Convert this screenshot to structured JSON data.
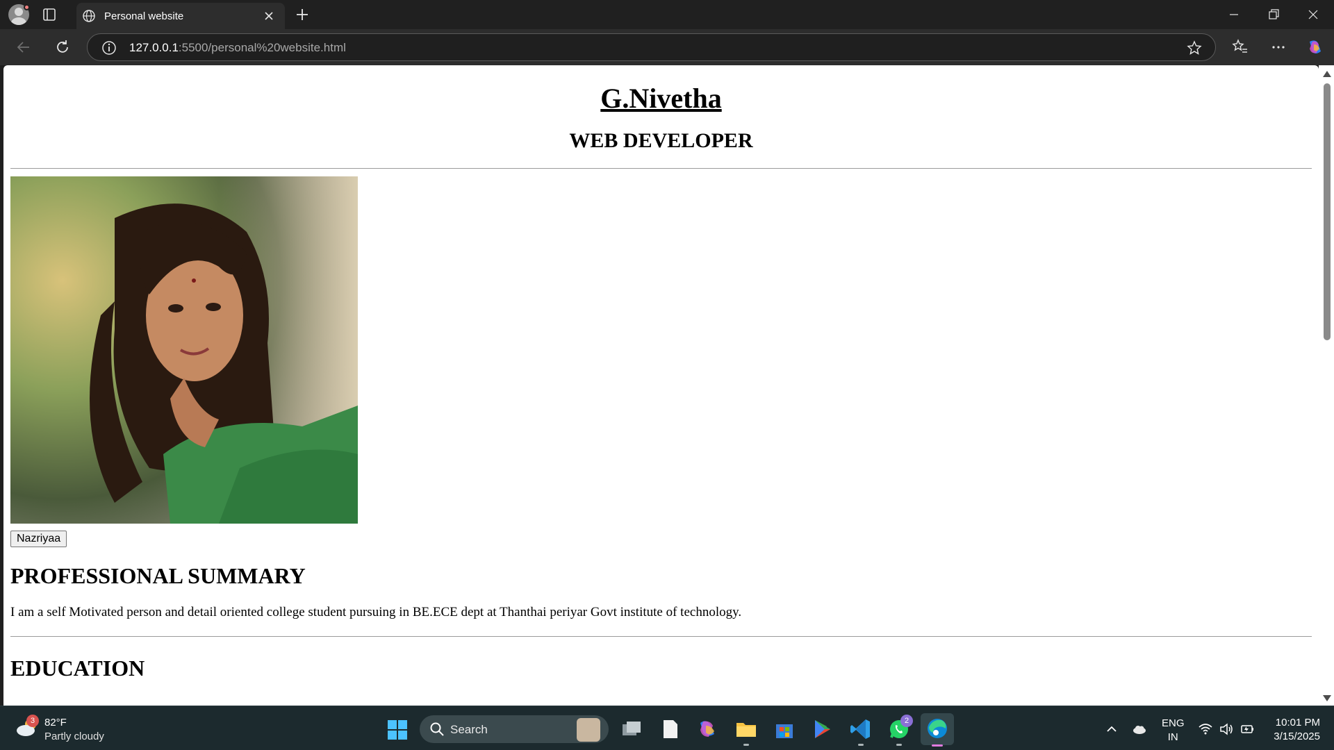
{
  "browser": {
    "tab_title": "Personal website",
    "url_host": "127.0.0.1",
    "url_rest": ":5500/personal%20website.html"
  },
  "page": {
    "name": "G.Nivetha",
    "role": "WEB DEVELOPER",
    "photo_caption_button": "Nazriyaa",
    "summary_heading": "PROFESSIONAL SUMMARY",
    "summary_text": "I am a self Motivated person and detail oriented college student pursuing in BE.ECE dept at Thanthai periyar Govt institute of technology.",
    "education_heading": "EDUCATION"
  },
  "taskbar": {
    "weather_badge": "3",
    "temperature": "82°F",
    "condition": "Partly cloudy",
    "search_label": "Search",
    "whatsapp_badge": "2",
    "lang_1": "ENG",
    "lang_2": "IN",
    "time": "10:01 PM",
    "date": "3/15/2025"
  },
  "colors": {
    "tab_bg": "#202020",
    "toolbar_bg": "#2d2d2d",
    "taskbar_bg": "#1c2a2e",
    "page_bg": "#ffffff"
  }
}
